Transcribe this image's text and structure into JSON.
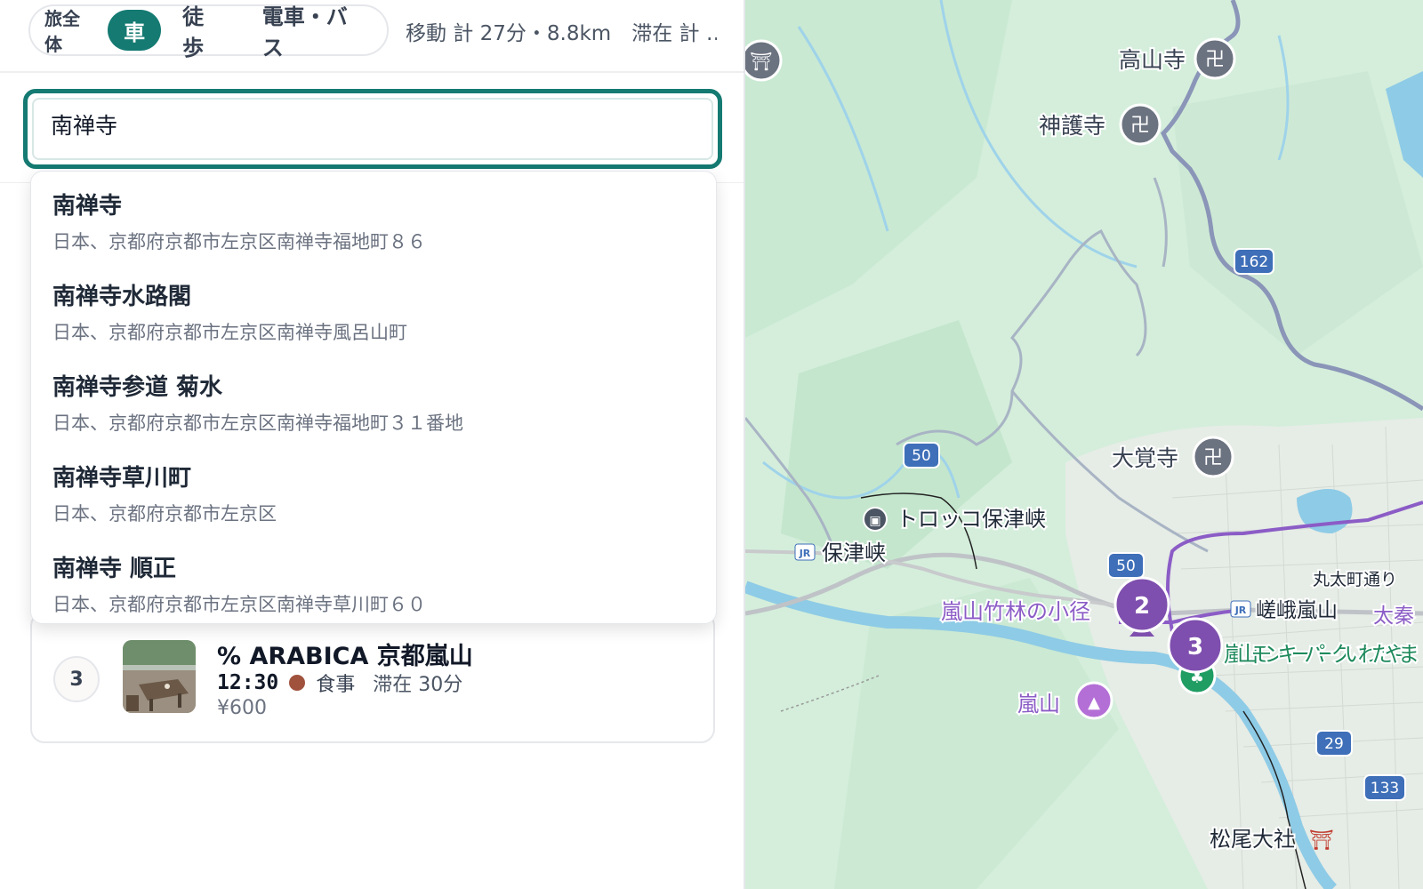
{
  "header": {
    "mode_label": "旅全体",
    "modes": [
      {
        "label": "車",
        "active": true
      },
      {
        "label": "徒歩",
        "active": false
      },
      {
        "label": "電車・バス",
        "active": false
      }
    ],
    "summary": "移動 計 27分・8.8km　滞在 計 …"
  },
  "search": {
    "value": "南禅寺"
  },
  "suggestions": [
    {
      "title": "南禅寺",
      "address": "日本、京都府京都市左京区南禅寺福地町８６"
    },
    {
      "title": "南禅寺水路閣",
      "address": "日本、京都府京都市左京区南禅寺風呂山町"
    },
    {
      "title": "南禅寺参道 菊水",
      "address": "日本、京都府京都市左京区南禅寺福地町３１番地"
    },
    {
      "title": "南禅寺草川町",
      "address": "日本、京都府京都市左京区"
    },
    {
      "title": "南禅寺 順正",
      "address": "日本、京都府京都市左京区南禅寺草川町６０"
    }
  ],
  "stop_card": {
    "number": "3",
    "name": "% ARABICA 京都嵐山",
    "time": "12:30",
    "category": "食事",
    "stay": "滞在 30分",
    "price": "¥600",
    "category_color": "#a0523d"
  },
  "map": {
    "labels": {
      "kozanji": "高山寺",
      "jingoji": "神護寺",
      "daikakuji": "大覚寺",
      "torokko": "トロッコ保津峡",
      "hozukyo": "保津峡",
      "bamboo": "嵐山竹林の小径",
      "arashiyama": "嵐山",
      "monkey_park": "嵐山モンキーパークいわたやま",
      "marutamachi": "丸太町通り",
      "saga_arashiyama": "嵯峨嵐山",
      "uzumasa": "太秦",
      "matsuo": "松尾大社"
    },
    "road_shields": [
      "162",
      "50",
      "50",
      "29",
      "133"
    ],
    "pins": [
      "2",
      "3"
    ],
    "colors": {
      "route": "#8b5cc6",
      "pin": "#7e4fae",
      "river": "#4a8fd6",
      "accent": "#147a72"
    }
  }
}
